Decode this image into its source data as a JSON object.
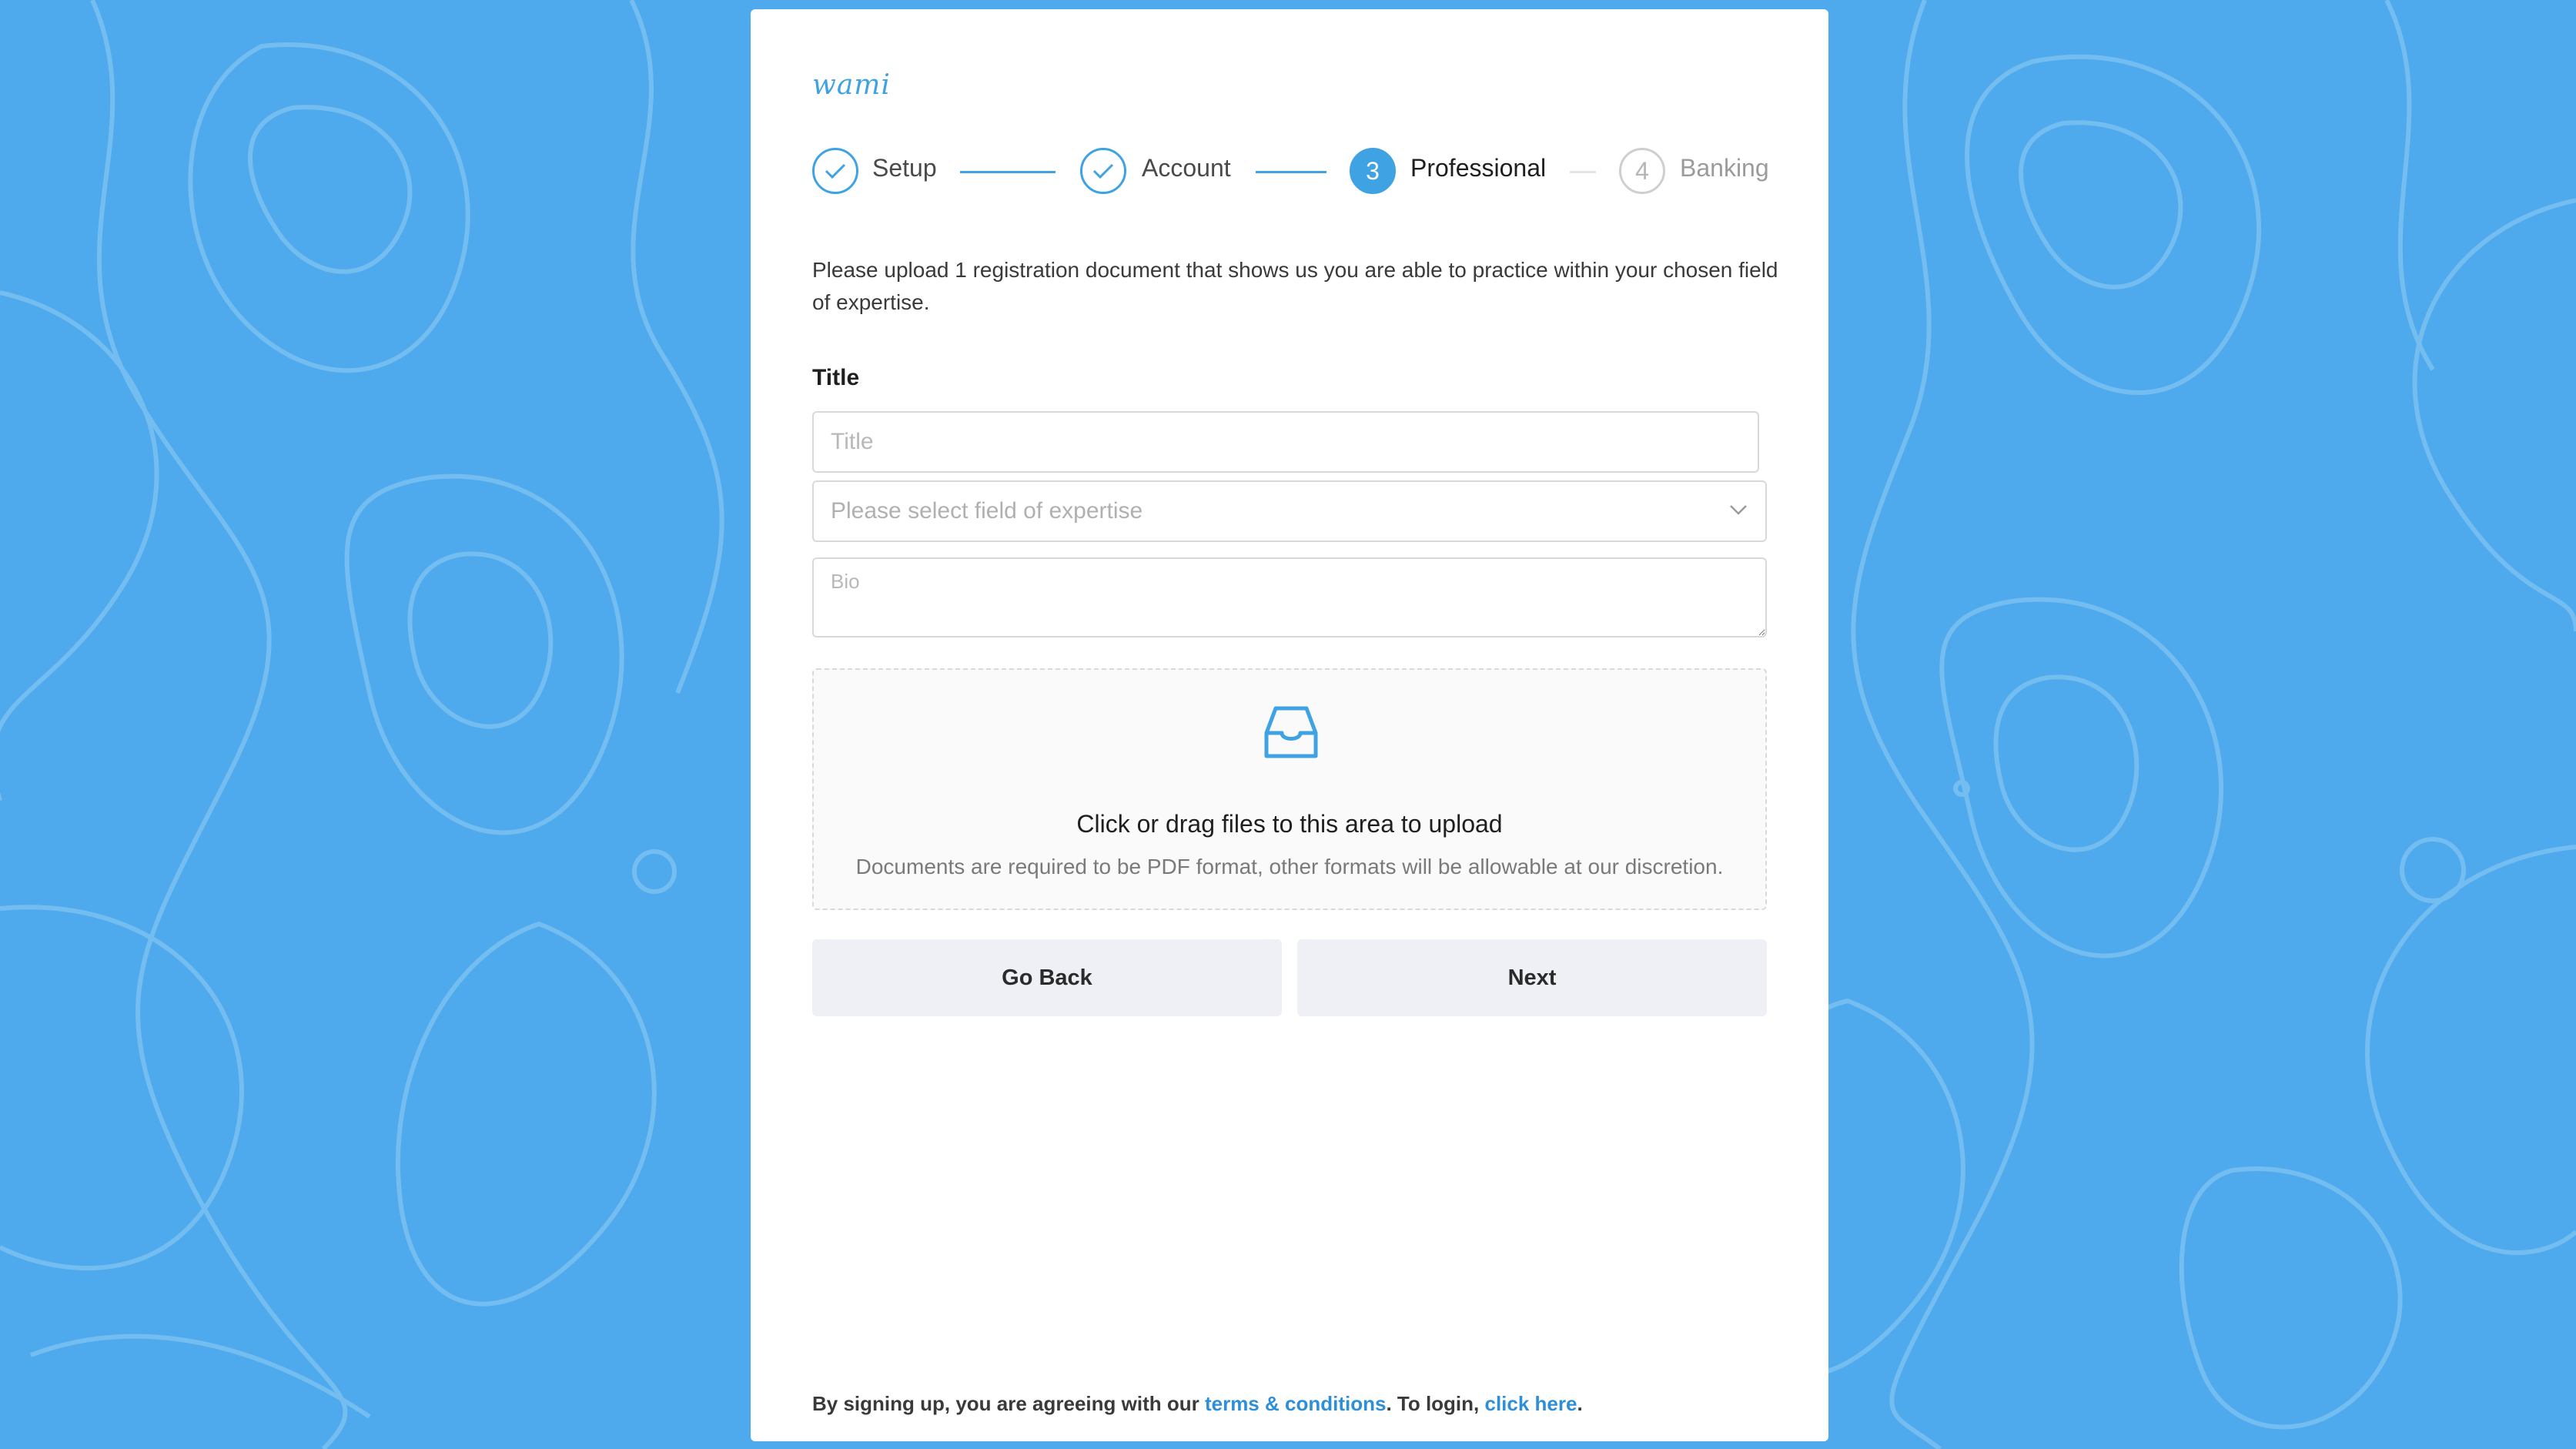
{
  "brand": {
    "logo_text": "wami",
    "accent_color": "#3fa2e3",
    "background_color": "#4eaaec"
  },
  "stepper": {
    "steps": [
      {
        "label": "Setup",
        "state": "completed",
        "icon": "check-icon"
      },
      {
        "label": "Account",
        "state": "completed",
        "icon": "check-icon"
      },
      {
        "number": "3",
        "label": "Professional",
        "state": "active"
      },
      {
        "number": "4",
        "label": "Banking",
        "state": "pending"
      }
    ]
  },
  "intro_text": "Please upload 1 registration document that shows us you are able to practice within your chosen field of expertise.",
  "form": {
    "title_label": "Title",
    "title_input": {
      "value": "",
      "placeholder": "Title"
    },
    "expertise_select": {
      "placeholder": "Please select field of expertise",
      "icon": "chevron-down-icon"
    },
    "bio_input": {
      "value": "",
      "placeholder": "Bio"
    }
  },
  "upload": {
    "icon": "inbox-icon",
    "title": "Click or drag files to this area to upload",
    "hint": "Documents are required to be PDF format, other formats will be allowable at our discretion."
  },
  "buttons": {
    "back_label": "Go Back",
    "next_label": "Next"
  },
  "footer": {
    "prefix": "By signing up, you are agreeing with our ",
    "terms_link": "terms & conditions",
    "middle": ". To login, ",
    "login_link": "click here",
    "suffix": "."
  }
}
